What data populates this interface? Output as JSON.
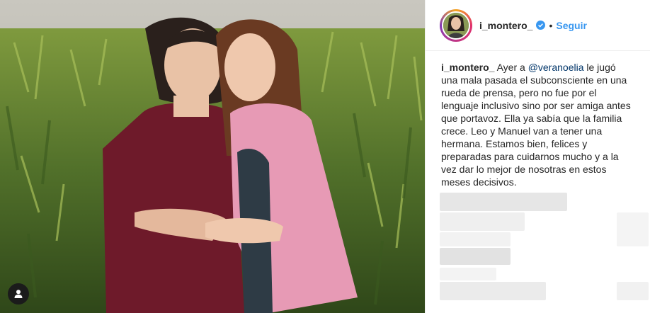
{
  "post": {
    "username": "i_montero_",
    "follow_label": "Seguir",
    "separator": "•",
    "caption": {
      "username": "i_montero_",
      "text_before": " Ayer a ",
      "mention": "@veranoelia",
      "text_after": " le jugó una mala pasada el subconsciente en una rueda de prensa, pero no fue por el lenguaje inclusivo sino por ser amiga antes que portavoz. Ella ya sabía que la familia crece. Leo y Manuel van a tener una hermana. Estamos bien, felices y preparadas para cuidarnos mucho y a la vez dar lo mejor de nosotras en estos meses decisivos."
    }
  },
  "icons": {
    "verified": "verified-badge-icon",
    "user_tag": "user-tag-icon"
  },
  "colors": {
    "follow": "#3897f0",
    "verified": "#3897f0",
    "mention": "#003569",
    "text": "#262626"
  }
}
